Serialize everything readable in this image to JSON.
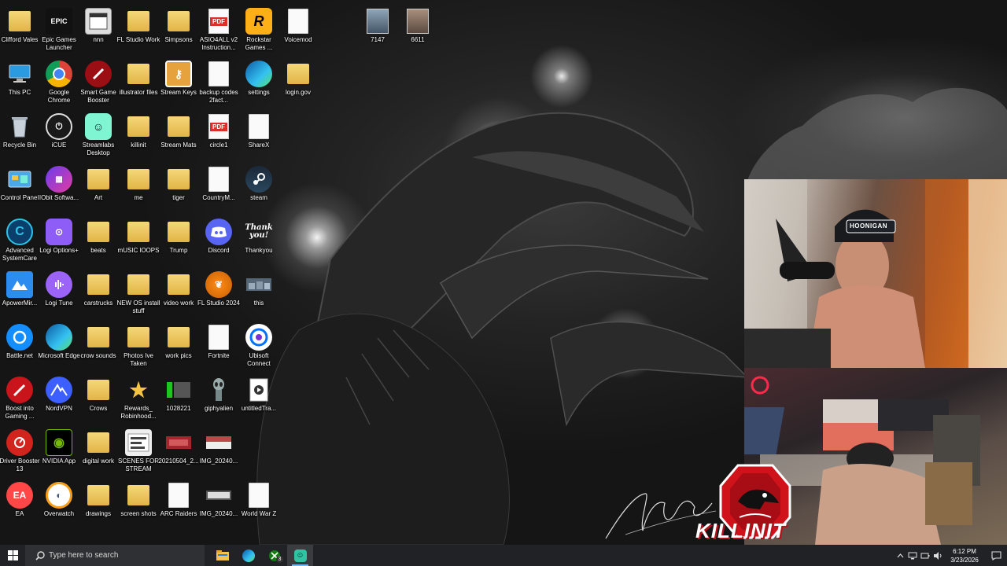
{
  "desktop_icons": [
    [
      "Clifford Vales",
      "Epic Games Launcher",
      "nnn",
      "FL Studio Work",
      "Simpsons",
      "ASIO4ALL v2 Instruction...",
      "Rockstar Games ...",
      "Voicemod"
    ],
    [
      "This PC",
      "Google Chrome",
      "Smart Game Booster",
      "illustrator files",
      "Stream Keys",
      "backup codes 2fact...",
      "settings",
      "login.gov"
    ],
    [
      "Recycle Bin",
      "iCUE",
      "Streamlabs Desktop",
      "killinit",
      "Stream Mats",
      "circle1",
      "ShareX"
    ],
    [
      "Control Panel",
      "IObit Softwa...",
      "Art",
      "me",
      "tiger",
      "CountryM...",
      "steam"
    ],
    [
      "Advanced SystemCare",
      "Logi Options+",
      "beats",
      "mUSIC lOOPS",
      "Trump",
      "Discord",
      "Thankyou"
    ],
    [
      "ApowerMir...",
      "Logi Tune",
      "carstrucks",
      "NEW OS install stuff",
      "video work",
      "FL Studio 2024",
      "this"
    ],
    [
      "Battle.net",
      "Microsoft Edge",
      "crow sounds",
      "Photos Ive Taken",
      "work pics",
      "Fortnite",
      "Ubisoft Connect"
    ],
    [
      "Boost into Gaming ...",
      "NordVPN",
      "Crows",
      "Rewards_ Robinhood...",
      "1028221",
      "giphyalien",
      "untitledTra..."
    ],
    [
      "Driver Booster 13",
      "NVIDIA App",
      "digital work",
      "SCENES FOR STREAM",
      "20210504_2...",
      "IMG_20240..."
    ],
    [
      "EA",
      "Overwatch",
      "drawings",
      "screen shots",
      "ARC Raiders",
      "IMG_20240...",
      "World War Z"
    ]
  ],
  "extra_icons": [
    "7147",
    "6611"
  ],
  "pdf_badge": "PDF",
  "epic_badge": "EPIC",
  "rockstar_badge": "R",
  "hoodie_text": "HOONIGAN",
  "stream_logo_text": "KILLINIT",
  "taskbar": {
    "search_placeholder": "Type here to search",
    "xbox_badge": "3",
    "time": "6:12 PM",
    "date": "3/23/2026"
  },
  "colors": {
    "taskbar_bg": "#202225",
    "accent": "#76b9ed",
    "logo_red": "#d0121b"
  }
}
